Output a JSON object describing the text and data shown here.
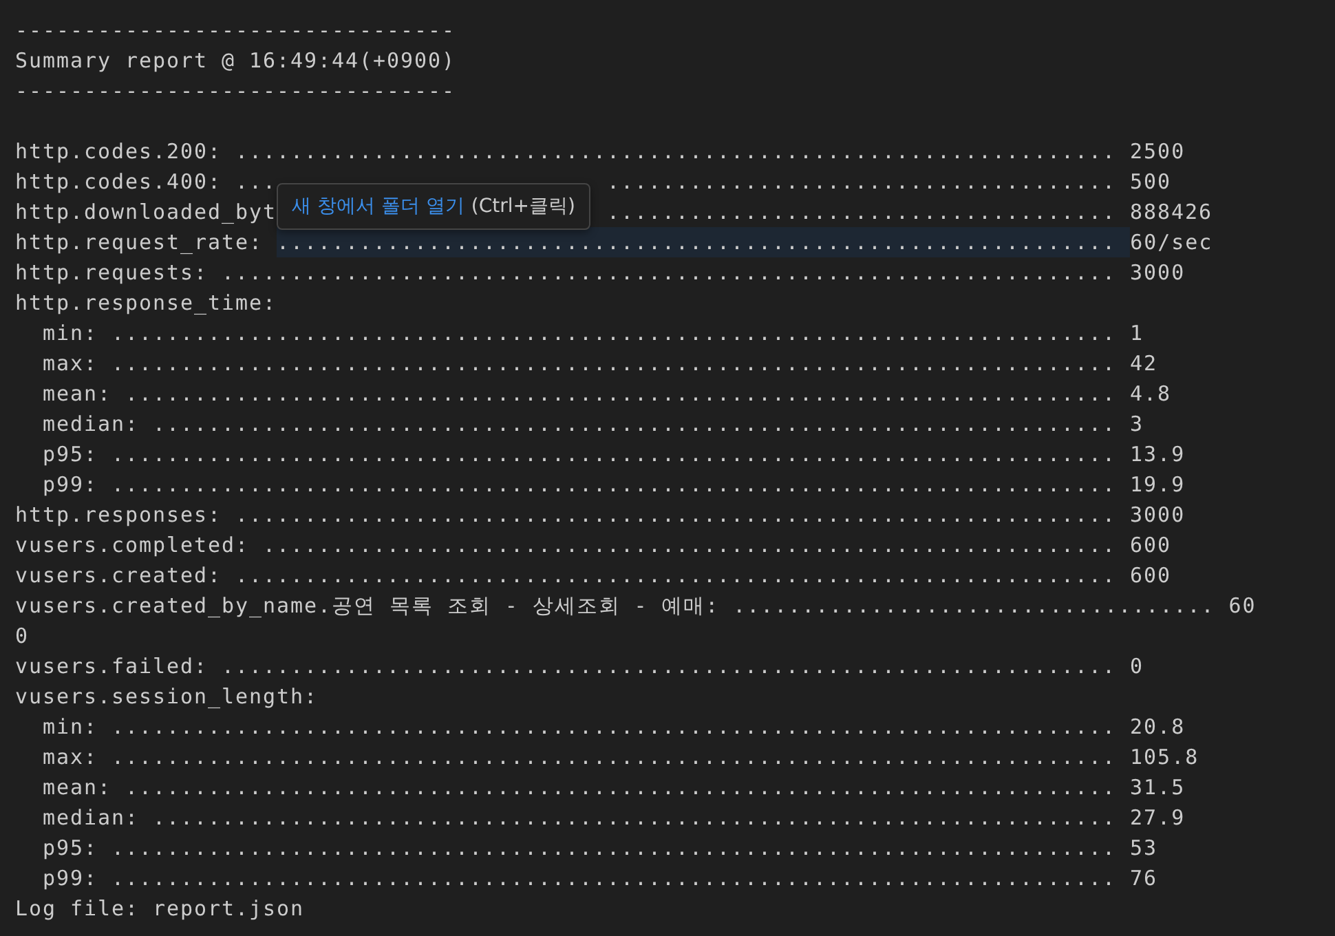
{
  "terminal": {
    "lines": [
      {
        "kind": "text",
        "text": "--------------------------------"
      },
      {
        "kind": "text",
        "text": "Summary report @ 16:49:44(+0900)"
      },
      {
        "kind": "text",
        "text": "--------------------------------"
      },
      {
        "kind": "blank"
      },
      {
        "kind": "text",
        "text": "http.codes.200: ................................................................ 2500"
      },
      {
        "kind": "segments",
        "segments": [
          {
            "kind": "text",
            "text": "http.codes.400: ..."
          },
          {
            "kind": "gap"
          },
          {
            "kind": "text",
            "text": "..................................... 500"
          }
        ]
      },
      {
        "kind": "segments",
        "segments": [
          {
            "kind": "text",
            "text": "http.downloaded_byt"
          },
          {
            "kind": "gap"
          },
          {
            "kind": "text",
            "text": "..................................... 888426"
          }
        ]
      },
      {
        "kind": "segments",
        "segments": [
          {
            "kind": "text",
            "text": "http.request_rate: "
          },
          {
            "kind": "link",
            "hovered": true,
            "text": "............................................................. "
          },
          {
            "kind": "text",
            "text": "60/sec"
          }
        ]
      },
      {
        "kind": "text",
        "text": "http.requests: ................................................................. 3000"
      },
      {
        "kind": "text",
        "text": "http.response_time:"
      },
      {
        "kind": "text",
        "text": "  min: ......................................................................... 1"
      },
      {
        "kind": "text",
        "text": "  max: ......................................................................... 42"
      },
      {
        "kind": "text",
        "text": "  mean: ........................................................................ 4.8"
      },
      {
        "kind": "text",
        "text": "  median: ...................................................................... 3"
      },
      {
        "kind": "text",
        "text": "  p95: ......................................................................... 13.9"
      },
      {
        "kind": "text",
        "text": "  p99: ......................................................................... 19.9"
      },
      {
        "kind": "text",
        "text": "http.responses: ................................................................ 3000"
      },
      {
        "kind": "text",
        "text": "vusers.completed: .............................................................. 600"
      },
      {
        "kind": "text",
        "text": "vusers.created: ................................................................ 600"
      },
      {
        "kind": "text",
        "text": "vusers.created_by_name.공연 목록 조회 - 상세조회 - 예매: ................................... 60"
      },
      {
        "kind": "text",
        "text": "0"
      },
      {
        "kind": "text",
        "text": "vusers.failed: ................................................................. 0"
      },
      {
        "kind": "text",
        "text": "vusers.session_length:"
      },
      {
        "kind": "text",
        "text": "  min: ......................................................................... 20.8"
      },
      {
        "kind": "text",
        "text": "  max: ......................................................................... 105.8"
      },
      {
        "kind": "text",
        "text": "  mean: ........................................................................ 31.5"
      },
      {
        "kind": "text",
        "text": "  median: ...................................................................... 27.9"
      },
      {
        "kind": "text",
        "text": "  p95: ......................................................................... 53"
      },
      {
        "kind": "text",
        "text": "  p99: ......................................................................... 76"
      },
      {
        "kind": "text",
        "text": "Log file: report.json"
      }
    ]
  },
  "tooltip": {
    "link_text": "새 창에서 폴더 열기",
    "hint": "(Ctrl+클릭)"
  }
}
